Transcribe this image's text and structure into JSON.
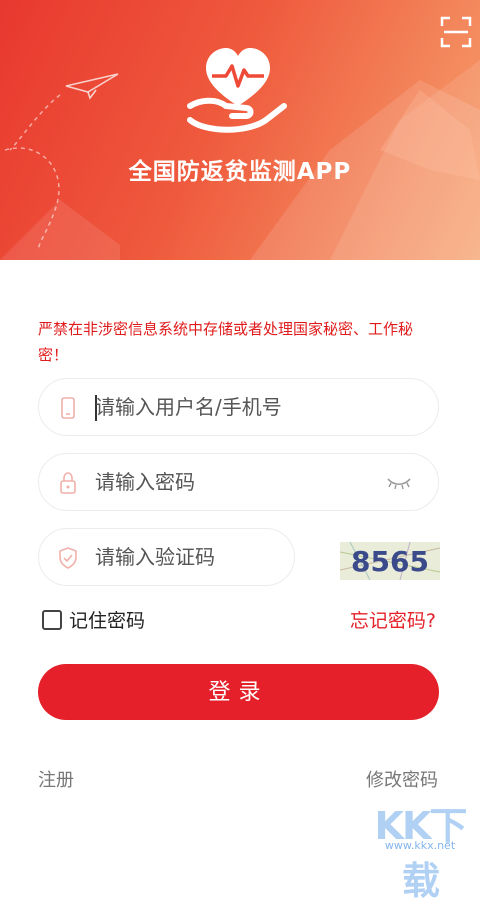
{
  "header": {
    "title": "全国防返贫监测APP",
    "colors": {
      "start": "#e8382f",
      "end": "#f6a470"
    },
    "icons": {
      "scan": "scan-icon",
      "logo": "heart-in-hand-icon",
      "plane": "paper-plane-icon"
    }
  },
  "warning": "严禁在非涉密信息系统中存储或者处理国家秘密、工作秘密！",
  "form": {
    "username_placeholder": "请输入用户名/手机号",
    "password_placeholder": "请输入密码",
    "captcha_placeholder": "请输入验证码",
    "captcha_code": "8565",
    "remember_label": "记住密码",
    "forgot_label": "忘记密码?",
    "login_label": "登录",
    "register_label": "注册",
    "change_password_label": "修改密码",
    "accent_color": "#e5202a"
  },
  "watermark": {
    "text": "KK下载",
    "url": "www.kkx.net"
  }
}
